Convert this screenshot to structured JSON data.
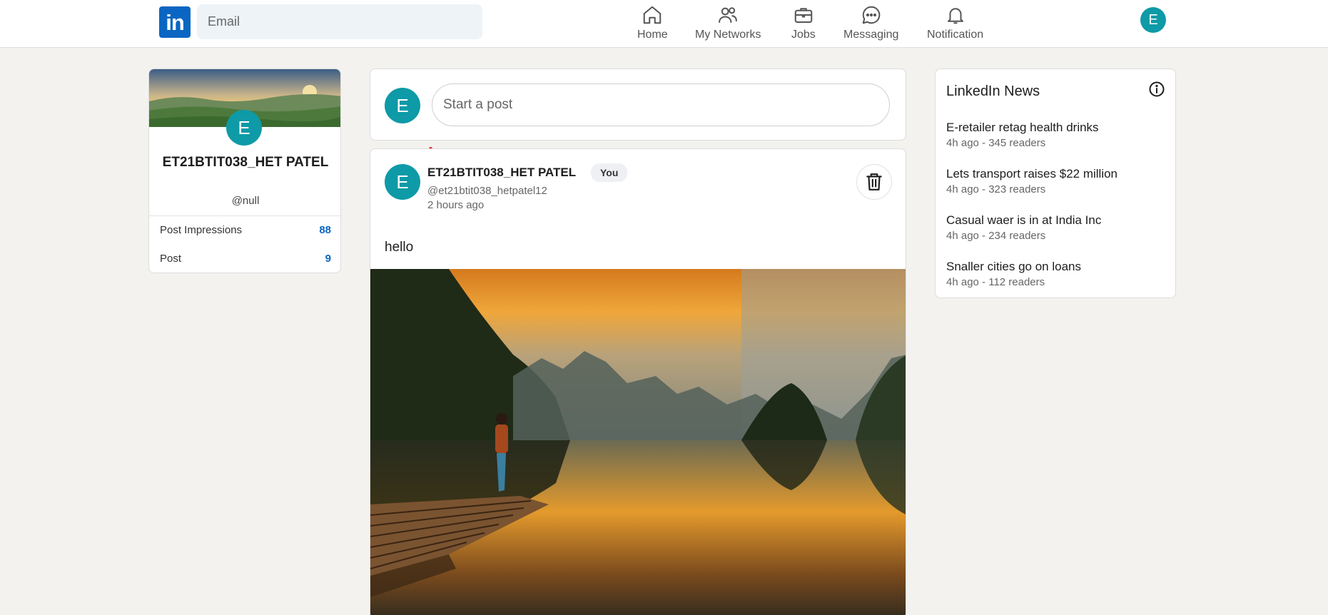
{
  "nav": {
    "logo_text": "in",
    "search_placeholder": "Email",
    "items": [
      {
        "label": "Home",
        "icon": "home-icon"
      },
      {
        "label": "My Networks",
        "icon": "people-icon"
      },
      {
        "label": "Jobs",
        "icon": "briefcase-icon"
      },
      {
        "label": "Messaging",
        "icon": "chat-icon"
      },
      {
        "label": "Notification",
        "icon": "bell-icon"
      }
    ],
    "user_initial": "E"
  },
  "profile": {
    "initial": "E",
    "name": "ET21BTIT038_HET PATEL",
    "handle": "@null",
    "stats": [
      {
        "label": "Post Impressions",
        "value": "88"
      },
      {
        "label": "Post",
        "value": "9"
      }
    ]
  },
  "composer": {
    "initial": "E",
    "placeholder": "Start a post"
  },
  "post": {
    "initial": "E",
    "author": "ET21BTIT038_HET PATEL",
    "badge": "You",
    "handle": "@et21btit038_hetpatel12",
    "time": "2 hours ago",
    "text": "hello"
  },
  "news": {
    "title": "LinkedIn News",
    "items": [
      {
        "headline": "E-retailer retag health drinks",
        "meta": "4h ago - 345 readers"
      },
      {
        "headline": "Lets transport raises $22 million",
        "meta": "4h ago - 323 readers"
      },
      {
        "headline": "Casual waer is in at India Inc",
        "meta": "4h ago - 234 readers"
      },
      {
        "headline": "Snaller cities go on loans",
        "meta": "4h ago - 112 readers"
      }
    ]
  },
  "colors": {
    "brand": "#0a66c2",
    "avatar": "#0e9aa7",
    "background": "#f3f2ef"
  }
}
